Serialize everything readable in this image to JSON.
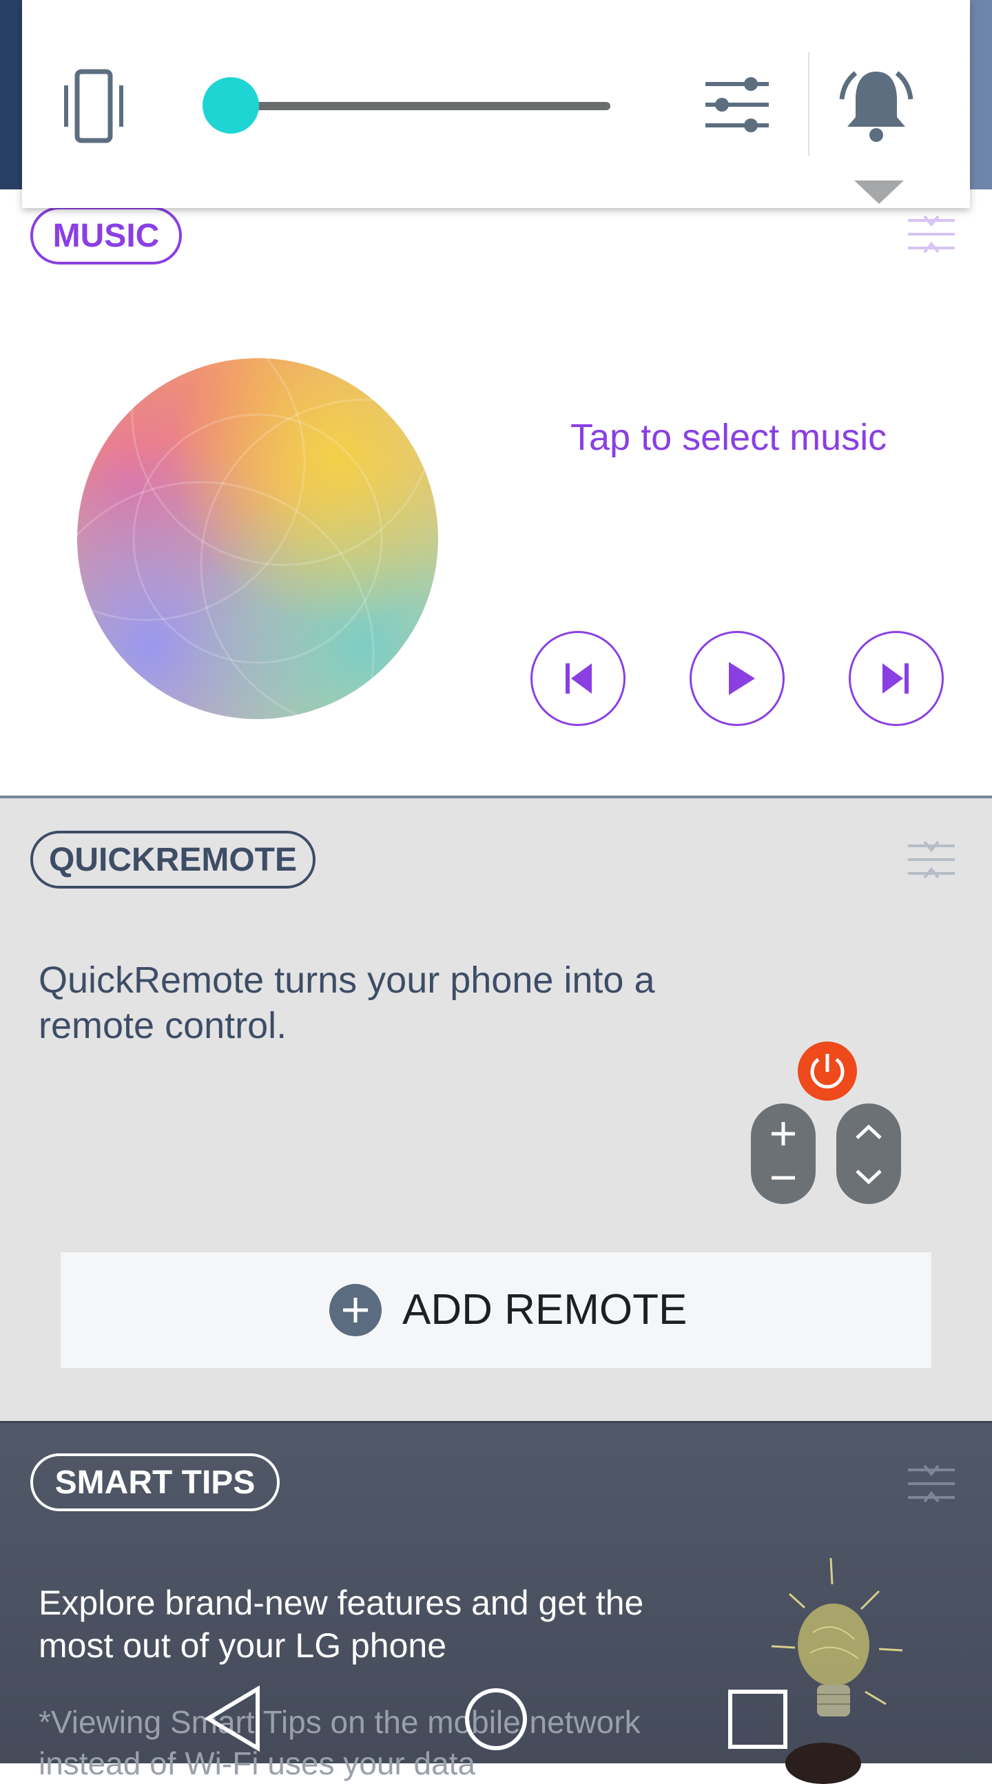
{
  "volume_panel": {
    "vibrate_icon": "vibrate-icon",
    "volume_level": 0.0,
    "settings_icon": "equalizer-sliders-icon",
    "notification_icon": "bell-icon",
    "expand_icon": "triangle-down-icon",
    "accent_color": "#1fd5d4"
  },
  "music": {
    "title": "MUSIC",
    "prompt": "Tap to select music",
    "accent_color": "#8a3fe3",
    "controls": {
      "previous": "skip-previous-icon",
      "play": "play-icon",
      "next": "skip-next-icon"
    }
  },
  "quickremote": {
    "title": "QUICKREMOTE",
    "description": "QuickRemote turns your phone into a remote control.",
    "add_button_label": "ADD REMOTE",
    "illustration": {
      "power_icon": "power-icon",
      "volume_plus": "+",
      "volume_minus": "–"
    }
  },
  "smart_tips": {
    "title": "SMART TIPS",
    "description": "Explore brand-new features and get the most out of your LG phone",
    "note": "*Viewing Smart Tips on the mobile network instead of Wi-Fi uses your data"
  },
  "nav_bar": {
    "back": "back-triangle-icon",
    "home": "home-circle-icon",
    "recents": "recents-square-icon"
  }
}
